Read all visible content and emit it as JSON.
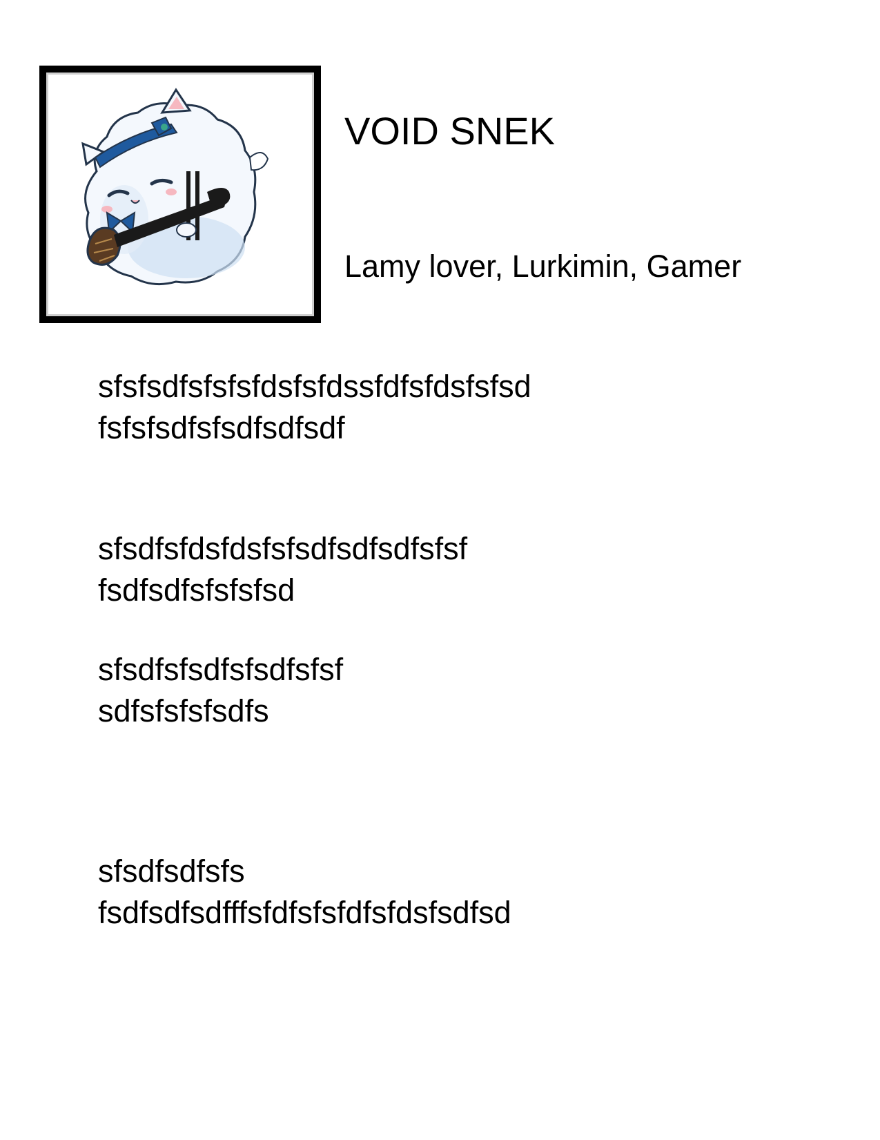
{
  "profile": {
    "name": "VOID SNEK",
    "tags": "Lamy lover, Lurkimin, Gamer"
  },
  "avatar": {
    "icon": "fluffy-cat-mascot-icon",
    "colors": {
      "fur": "#f4f8fd",
      "fur_shadow": "#cddff2",
      "outline": "#23344a",
      "ribbon": "#1f5a9e",
      "instrument_body": "#5a3b22",
      "instrument_neck": "#1a1a1a",
      "blush": "#f6b8c0"
    }
  },
  "paragraphs": [
    {
      "line1": "sfsfsdfsfsfsfdsfsfdssfdfsfdsfsfsd",
      "line2": "fsfsfsdfsfsdfsdfsdf"
    },
    {
      "line1": "sfsdfsfdsfdsfsfsdfsdfsdfsfsf",
      "line2": "fsdfsdfsfsfsfsd"
    },
    {
      "line1": "sfsdfsfsdfsfsdfsfsf",
      "line2": "sdfsfsfsfsdfs"
    },
    {
      "line1": "sfsdfsdfsfs",
      "line2": "fsdfsdfsdfffsfdfsfsfdfsfdsfsdfsd"
    }
  ]
}
